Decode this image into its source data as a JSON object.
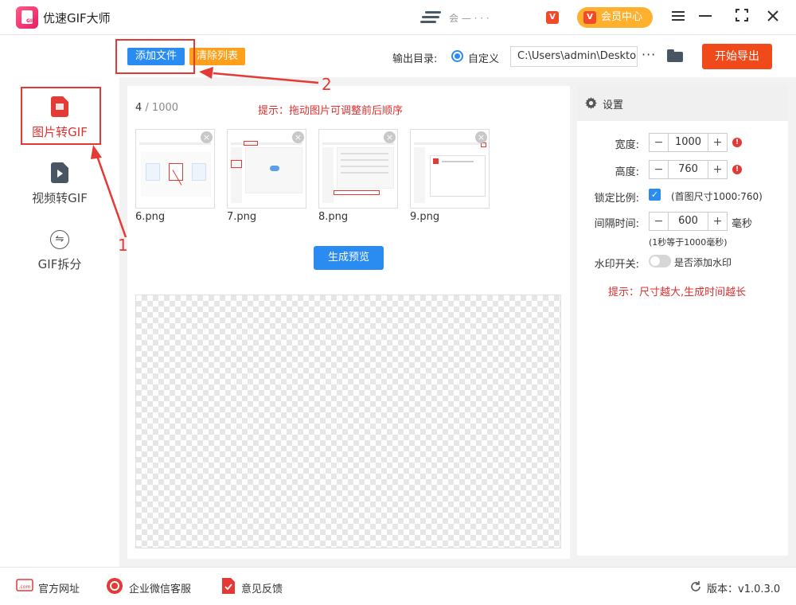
{
  "app": {
    "title": "优速GIF大师",
    "logo_text": "GIF",
    "titlebar_blur_text": "会 — ·    ·  ·",
    "vip_label": "会员中心",
    "vip_icon": "V"
  },
  "toolbar": {
    "add_file": "添加文件",
    "clear_list": "清除列表",
    "output_label": "输出目录:",
    "output_option": "自定义",
    "output_path": "C:\\Users\\admin\\Desktop",
    "more": "···",
    "export": "开始导出"
  },
  "sidebar": {
    "items": [
      {
        "label": "图片转GIF",
        "icon": "image-doc-icon",
        "active": true
      },
      {
        "label": "视频转GIF",
        "icon": "video-doc-icon",
        "active": false
      },
      {
        "label": "GIF拆分",
        "icon": "split-icon",
        "active": false
      }
    ]
  },
  "main": {
    "count_current": "4",
    "count_total": " / 1000",
    "hint": "提示：拖动图片可调整前后顺序",
    "thumbnails": [
      {
        "name": "6.png"
      },
      {
        "name": "7.png"
      },
      {
        "name": "8.png"
      },
      {
        "name": "9.png"
      }
    ],
    "preview_button": "生成预览"
  },
  "settings": {
    "title": "设置",
    "width_label": "宽度:",
    "width_value": "1000",
    "height_label": "高度:",
    "height_value": "760",
    "lock_label": "锁定比例:",
    "lock_note": "(首图尺寸1000:760)",
    "lock_checked": true,
    "interval_label": "间隔时间:",
    "interval_value": "600",
    "interval_unit": "毫秒",
    "interval_note": "(1秒等于1000毫秒)",
    "watermark_label": "水印开关:",
    "watermark_note": "是否添加水印",
    "watermark_on": false,
    "hint": "提示：尺寸越大,生成时间越长",
    "warn_icon": "!"
  },
  "footer": {
    "website": "官方网址",
    "wechat": "企业微信客服",
    "feedback": "意见反馈",
    "version": "版本：v1.0.3.0"
  },
  "annotations": {
    "step1": "1",
    "step2": "2"
  },
  "colors": {
    "accent_blue": "#2a8cf0",
    "accent_red": "#e53935",
    "export_orange": "#f04a1a",
    "clear_orange": "#ff9f1a",
    "vip_orange": "#ffb02e"
  }
}
